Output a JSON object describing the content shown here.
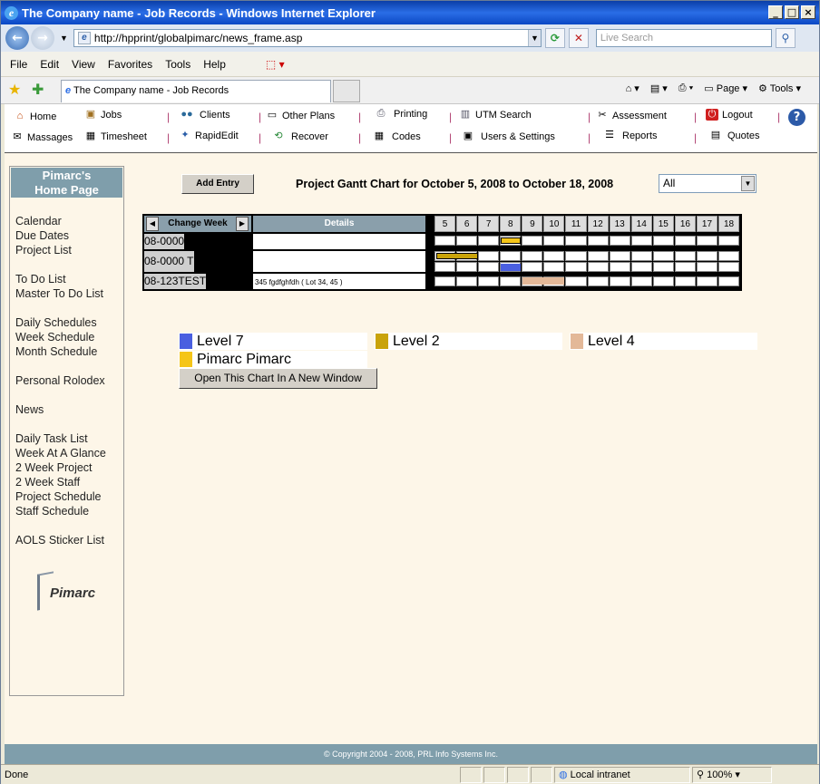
{
  "window": {
    "title": "The Company name - Job Records - Windows Internet Explorer"
  },
  "browser": {
    "address": "http://hpprint/globalpimarc/news_frame.asp",
    "search_placeholder": "Live Search",
    "menu": [
      "File",
      "Edit",
      "View",
      "Favorites",
      "Tools",
      "Help"
    ],
    "tab_title": "The Company name - Job Records",
    "fav_tools": {
      "page": "Page",
      "tools": "Tools"
    },
    "status_text": "Done",
    "zone": "Local intranet",
    "zoom": "100%"
  },
  "topnav": {
    "row1": [
      "Home",
      "Jobs",
      "Clients",
      "Other Plans",
      "Printing",
      "UTM Search",
      "Assessment",
      "Logout"
    ],
    "row2": [
      "Massages",
      "Timesheet",
      "RapidEdit",
      "Recover",
      "Codes",
      "Users & Settings",
      "Reports",
      "Quotes"
    ]
  },
  "sidebar": {
    "header_line1": "Pimarc's",
    "header_line2": "Home Page",
    "groups": [
      [
        "Calendar",
        "Due Dates",
        "Project List"
      ],
      [
        "To Do List",
        "Master To Do List"
      ],
      [
        "Daily Schedules",
        "Week Schedule",
        "Month Schedule"
      ],
      [
        "Personal Rolodex"
      ],
      [
        "News"
      ],
      [
        "Daily Task List",
        "Week At A Glance",
        "2 Week Project",
        "2 Week Staff",
        "Project Schedule",
        "Staff Schedule"
      ],
      [
        "AOLS Sticker List"
      ]
    ],
    "logo_text": "Pimarc"
  },
  "main": {
    "add_entry": "Add Entry",
    "chart_title": "Project Gantt Chart for October 5, 2008 to October 18, 2008",
    "filter_value": "All",
    "change_week": "Change Week",
    "details_header": "Details",
    "days": [
      "5",
      "6",
      "7",
      "8",
      "9",
      "10",
      "11",
      "12",
      "13",
      "14",
      "15",
      "16",
      "17",
      "18"
    ],
    "jobs": [
      {
        "id": "08-0000",
        "details": ""
      },
      {
        "id": "08-0000 T",
        "details": ""
      },
      {
        "id": "08-123TEST",
        "details": "345 fgdfghfdh ( Lot 34, 45 )"
      }
    ],
    "legend": [
      {
        "label": "Level 7",
        "color": "#4a5fe0"
      },
      {
        "label": "Level 2",
        "color": "#c9a30a"
      },
      {
        "label": "Level 4",
        "color": "#e3b898"
      },
      {
        "label": "Pimarc Pimarc",
        "color": "#f5c518"
      }
    ],
    "open_window": "Open This Chart In A New Window",
    "footer": "© Copyright 2004 - 2008, PRL Info Systems Inc."
  }
}
